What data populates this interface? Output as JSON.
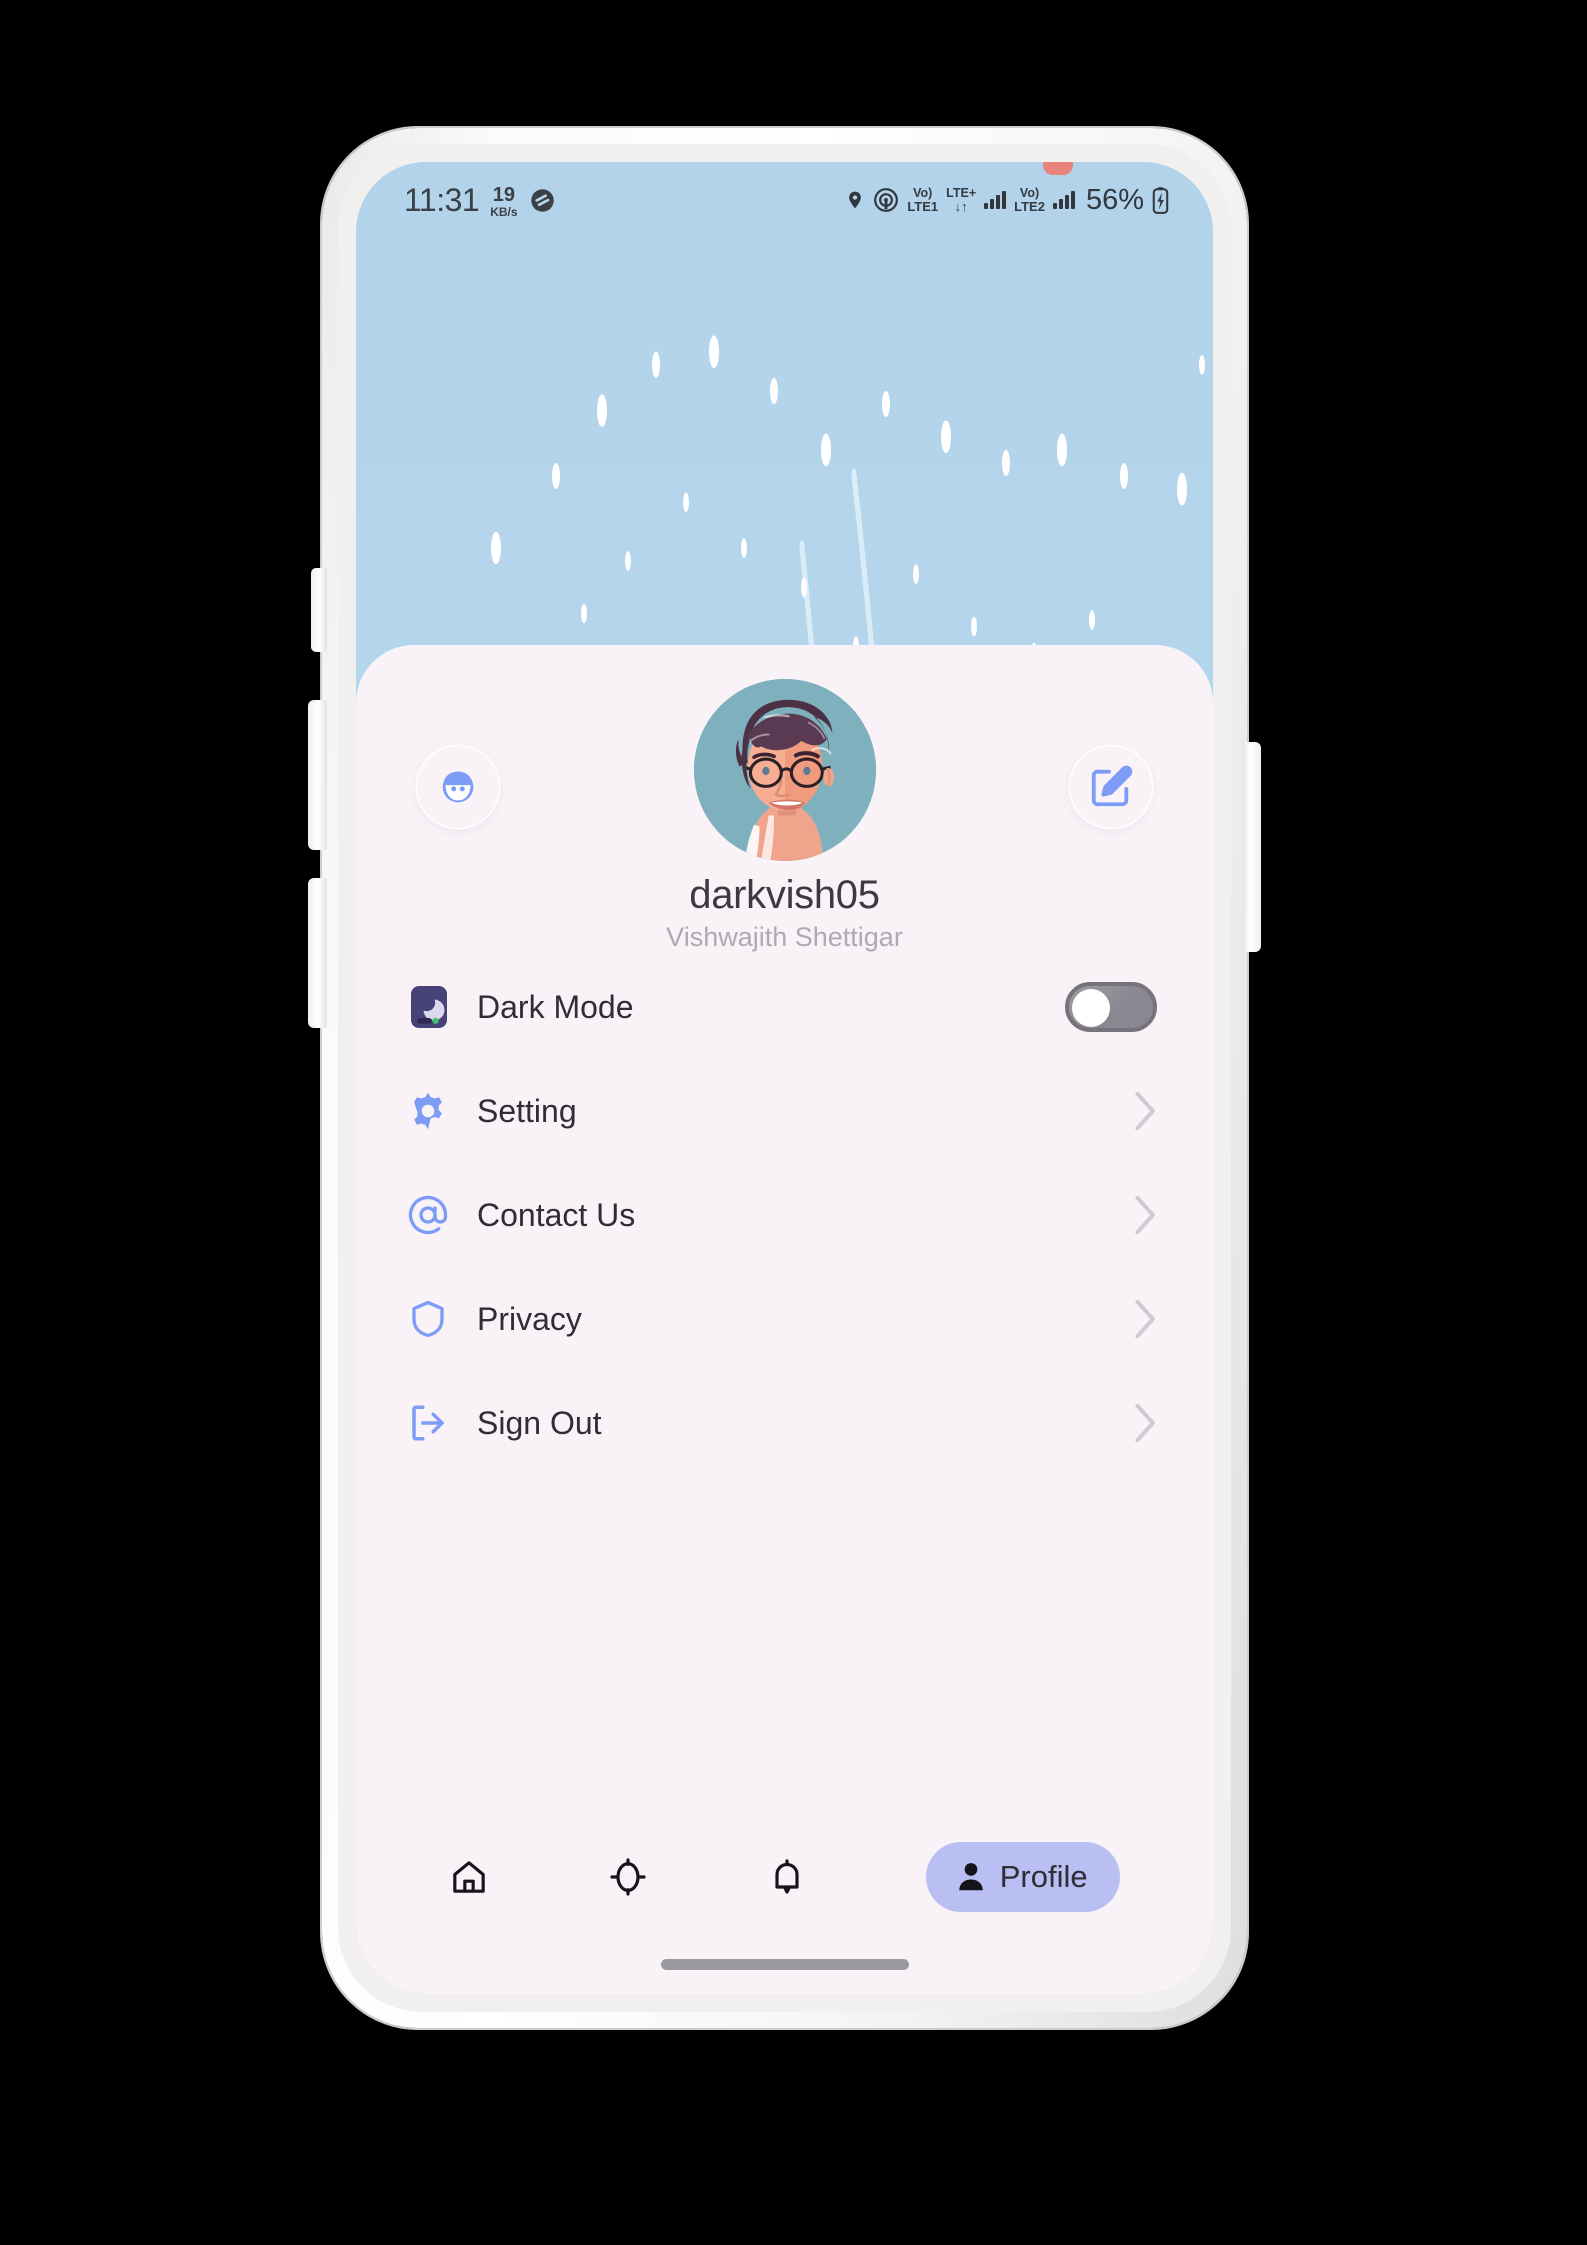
{
  "status_bar": {
    "time": "11:31",
    "network_speed_value": "19",
    "network_speed_unit": "KB/s",
    "dnd_icon": "do-not-disturb-icon",
    "location_icon": "location-pin-icon",
    "hotspot_icon": "hotspot-icon",
    "sim1_volte_top": "Vo)",
    "sim1_volte_bottom": "LTE1",
    "network_type_top": "LTE+",
    "network_type_bottom": "↓↑",
    "sim2_volte_top": "Vo)",
    "sim2_volte_bottom": "LTE2",
    "battery_percent": "56%",
    "battery_icon": "battery-charging-icon"
  },
  "profile": {
    "avatar_alt": "user-avatar-illustration",
    "left_button_icon": "avatar-face-icon",
    "right_button_icon": "edit-pencil-icon",
    "username": "darkvish05",
    "fullname": "Vishwajith Shettigar"
  },
  "menu": {
    "items": [
      {
        "label": "Dark Mode",
        "icon": "moon-dark-mode-icon",
        "control": "toggle",
        "toggle_on": false
      },
      {
        "label": "Setting",
        "icon": "gear-icon",
        "control": "chevron"
      },
      {
        "label": "Contact Us",
        "icon": "at-sign-icon",
        "control": "chevron"
      },
      {
        "label": "Privacy",
        "icon": "shield-icon",
        "control": "chevron"
      },
      {
        "label": "Sign Out",
        "icon": "sign-out-icon",
        "control": "chevron"
      }
    ]
  },
  "bottom_nav": {
    "items": [
      {
        "label": "",
        "icon": "home-icon",
        "active": false
      },
      {
        "label": "",
        "icon": "explore-compass-icon",
        "active": false
      },
      {
        "label": "",
        "icon": "bell-notification-icon",
        "active": false
      },
      {
        "label": "Profile",
        "icon": "person-icon",
        "active": true
      }
    ]
  },
  "colors": {
    "accent_blue": "#7d9cf5",
    "card_background": "#f9f3f8",
    "wallpaper_blue": "#b5d6ec",
    "active_pill": "#b9bff2",
    "dark_mode_tile": "#474277",
    "toggle_off": "#8a8790"
  }
}
